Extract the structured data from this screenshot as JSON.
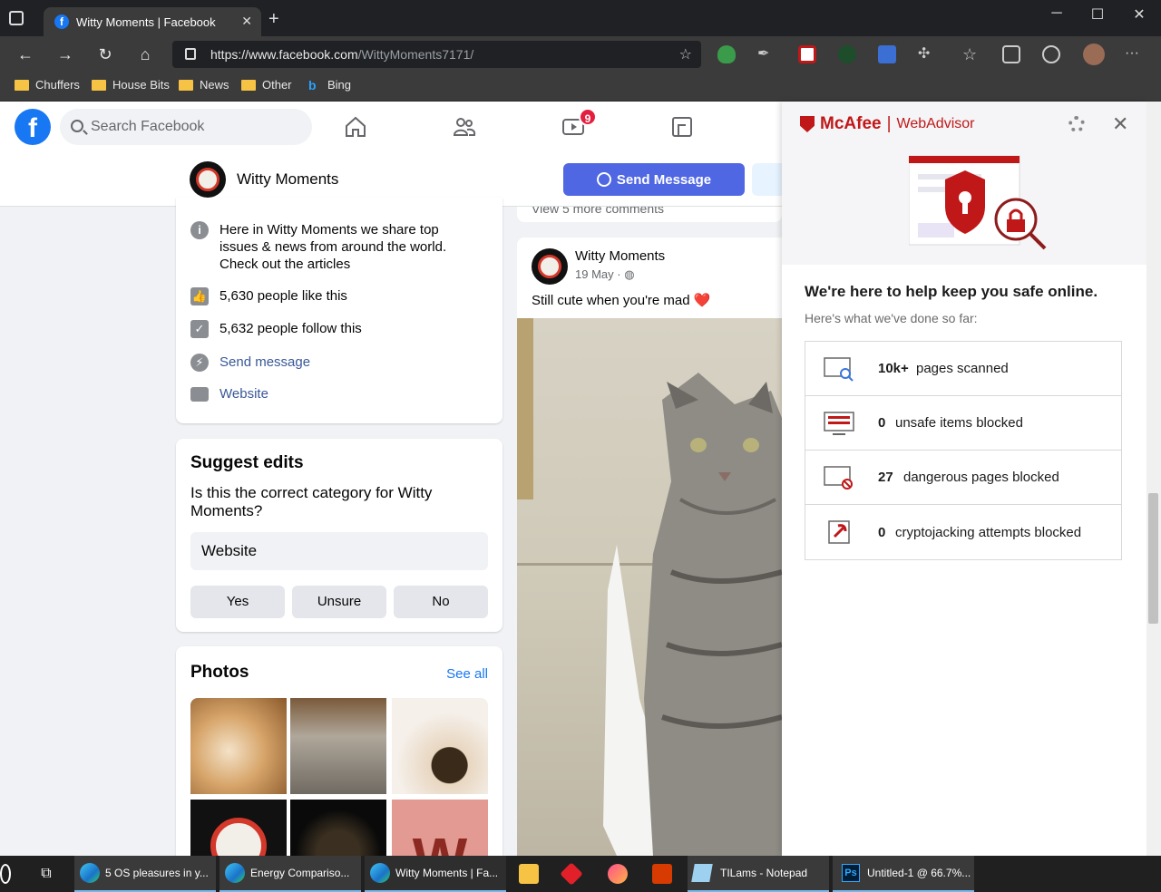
{
  "browser": {
    "tab_title": "Witty Moments | Facebook",
    "url_host": "https://www.facebook.com",
    "url_path": "/WittyMoments7171/",
    "bookmarks": [
      "Chuffers",
      "House Bits",
      "News",
      "Other",
      "Bing"
    ]
  },
  "fb": {
    "search_placeholder": "Search Facebook",
    "video_badge": "9",
    "page_name": "Witty Moments",
    "send_message": "Send Message",
    "prev_comments": "View 5 more comments"
  },
  "intro": {
    "description": "Here in Witty Moments we share top issues & news from around the world. Check out the articles",
    "likes": "5,630 people like this",
    "follows": "5,632 people follow this",
    "send_message": "Send message",
    "website": "Website"
  },
  "suggest": {
    "title": "Suggest edits",
    "question": "Is this the correct category for Witty Moments?",
    "category": "Website",
    "buttons": [
      "Yes",
      "Unsure",
      "No"
    ]
  },
  "photos": {
    "title": "Photos",
    "see_all": "See all"
  },
  "post": {
    "author": "Witty Moments",
    "date": "19 May · ",
    "text": "Still cute when you're mad ❤️"
  },
  "mcafee": {
    "brand": "McAfee",
    "product": "WebAdvisor",
    "headline": "We're here to help keep you safe online.",
    "subhead": "Here's what we've done so far:",
    "stats": [
      {
        "value": "10k+",
        "label": "pages scanned"
      },
      {
        "value": "0",
        "label": "unsafe items blocked"
      },
      {
        "value": "27",
        "label": "dangerous pages blocked"
      },
      {
        "value": "0",
        "label": "cryptojacking attempts blocked"
      }
    ]
  },
  "taskbar": {
    "items": [
      "5 OS pleasures in y...",
      "Energy Compariso...",
      "Witty Moments | Fa...",
      "TILams - Notepad",
      "Untitled-1 @ 66.7%..."
    ]
  },
  "colors": {
    "fb_blue": "#1877f2",
    "send_btn": "#4f67e3",
    "mcafee_red": "#c01818"
  }
}
